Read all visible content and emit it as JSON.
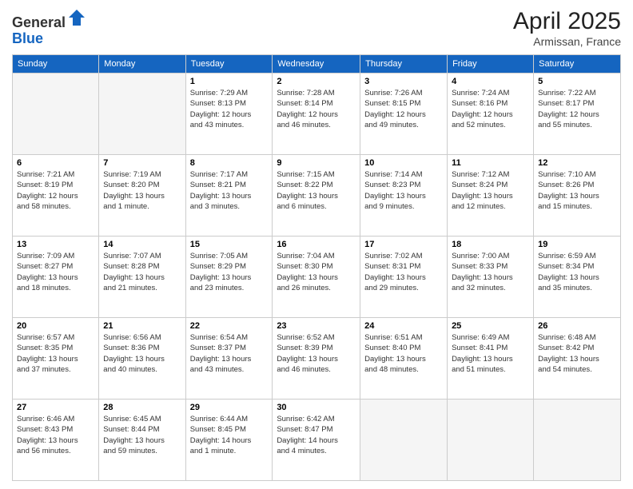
{
  "logo": {
    "general": "General",
    "blue": "Blue"
  },
  "title": {
    "month": "April 2025",
    "location": "Armissan, France"
  },
  "headers": [
    "Sunday",
    "Monday",
    "Tuesday",
    "Wednesday",
    "Thursday",
    "Friday",
    "Saturday"
  ],
  "weeks": [
    [
      {
        "day": "",
        "info": ""
      },
      {
        "day": "",
        "info": ""
      },
      {
        "day": "1",
        "info": "Sunrise: 7:29 AM\nSunset: 8:13 PM\nDaylight: 12 hours\nand 43 minutes."
      },
      {
        "day": "2",
        "info": "Sunrise: 7:28 AM\nSunset: 8:14 PM\nDaylight: 12 hours\nand 46 minutes."
      },
      {
        "day": "3",
        "info": "Sunrise: 7:26 AM\nSunset: 8:15 PM\nDaylight: 12 hours\nand 49 minutes."
      },
      {
        "day": "4",
        "info": "Sunrise: 7:24 AM\nSunset: 8:16 PM\nDaylight: 12 hours\nand 52 minutes."
      },
      {
        "day": "5",
        "info": "Sunrise: 7:22 AM\nSunset: 8:17 PM\nDaylight: 12 hours\nand 55 minutes."
      }
    ],
    [
      {
        "day": "6",
        "info": "Sunrise: 7:21 AM\nSunset: 8:19 PM\nDaylight: 12 hours\nand 58 minutes."
      },
      {
        "day": "7",
        "info": "Sunrise: 7:19 AM\nSunset: 8:20 PM\nDaylight: 13 hours\nand 1 minute."
      },
      {
        "day": "8",
        "info": "Sunrise: 7:17 AM\nSunset: 8:21 PM\nDaylight: 13 hours\nand 3 minutes."
      },
      {
        "day": "9",
        "info": "Sunrise: 7:15 AM\nSunset: 8:22 PM\nDaylight: 13 hours\nand 6 minutes."
      },
      {
        "day": "10",
        "info": "Sunrise: 7:14 AM\nSunset: 8:23 PM\nDaylight: 13 hours\nand 9 minutes."
      },
      {
        "day": "11",
        "info": "Sunrise: 7:12 AM\nSunset: 8:24 PM\nDaylight: 13 hours\nand 12 minutes."
      },
      {
        "day": "12",
        "info": "Sunrise: 7:10 AM\nSunset: 8:26 PM\nDaylight: 13 hours\nand 15 minutes."
      }
    ],
    [
      {
        "day": "13",
        "info": "Sunrise: 7:09 AM\nSunset: 8:27 PM\nDaylight: 13 hours\nand 18 minutes."
      },
      {
        "day": "14",
        "info": "Sunrise: 7:07 AM\nSunset: 8:28 PM\nDaylight: 13 hours\nand 21 minutes."
      },
      {
        "day": "15",
        "info": "Sunrise: 7:05 AM\nSunset: 8:29 PM\nDaylight: 13 hours\nand 23 minutes."
      },
      {
        "day": "16",
        "info": "Sunrise: 7:04 AM\nSunset: 8:30 PM\nDaylight: 13 hours\nand 26 minutes."
      },
      {
        "day": "17",
        "info": "Sunrise: 7:02 AM\nSunset: 8:31 PM\nDaylight: 13 hours\nand 29 minutes."
      },
      {
        "day": "18",
        "info": "Sunrise: 7:00 AM\nSunset: 8:33 PM\nDaylight: 13 hours\nand 32 minutes."
      },
      {
        "day": "19",
        "info": "Sunrise: 6:59 AM\nSunset: 8:34 PM\nDaylight: 13 hours\nand 35 minutes."
      }
    ],
    [
      {
        "day": "20",
        "info": "Sunrise: 6:57 AM\nSunset: 8:35 PM\nDaylight: 13 hours\nand 37 minutes."
      },
      {
        "day": "21",
        "info": "Sunrise: 6:56 AM\nSunset: 8:36 PM\nDaylight: 13 hours\nand 40 minutes."
      },
      {
        "day": "22",
        "info": "Sunrise: 6:54 AM\nSunset: 8:37 PM\nDaylight: 13 hours\nand 43 minutes."
      },
      {
        "day": "23",
        "info": "Sunrise: 6:52 AM\nSunset: 8:39 PM\nDaylight: 13 hours\nand 46 minutes."
      },
      {
        "day": "24",
        "info": "Sunrise: 6:51 AM\nSunset: 8:40 PM\nDaylight: 13 hours\nand 48 minutes."
      },
      {
        "day": "25",
        "info": "Sunrise: 6:49 AM\nSunset: 8:41 PM\nDaylight: 13 hours\nand 51 minutes."
      },
      {
        "day": "26",
        "info": "Sunrise: 6:48 AM\nSunset: 8:42 PM\nDaylight: 13 hours\nand 54 minutes."
      }
    ],
    [
      {
        "day": "27",
        "info": "Sunrise: 6:46 AM\nSunset: 8:43 PM\nDaylight: 13 hours\nand 56 minutes."
      },
      {
        "day": "28",
        "info": "Sunrise: 6:45 AM\nSunset: 8:44 PM\nDaylight: 13 hours\nand 59 minutes."
      },
      {
        "day": "29",
        "info": "Sunrise: 6:44 AM\nSunset: 8:45 PM\nDaylight: 14 hours\nand 1 minute."
      },
      {
        "day": "30",
        "info": "Sunrise: 6:42 AM\nSunset: 8:47 PM\nDaylight: 14 hours\nand 4 minutes."
      },
      {
        "day": "",
        "info": ""
      },
      {
        "day": "",
        "info": ""
      },
      {
        "day": "",
        "info": ""
      }
    ]
  ]
}
